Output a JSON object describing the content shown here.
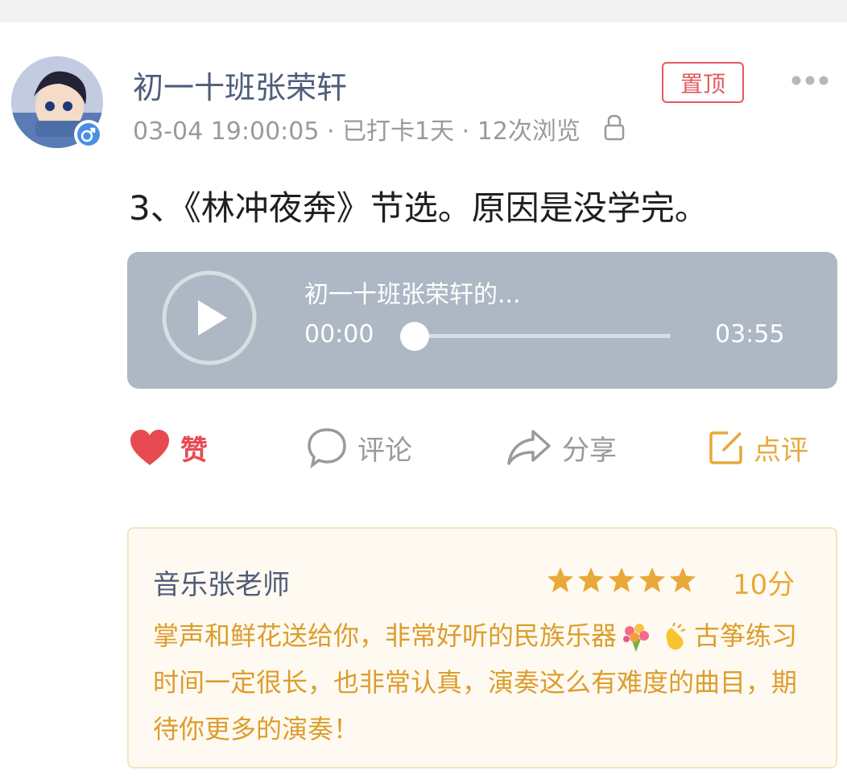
{
  "post": {
    "username": "初一十班张荣轩",
    "meta": "03-04 19:00:05 · 已打卡1天 · 12次浏览",
    "pin_label": "置顶",
    "text": "3、《林冲夜奔》节选。原因是没学完。"
  },
  "audio": {
    "title": "初一十班张荣轩的...",
    "current_time": "00:00",
    "total_time": "03:55",
    "progress": 0.05
  },
  "actions": {
    "like": "赞",
    "comment": "评论",
    "share": "分享",
    "review": "点评"
  },
  "review": {
    "reviewer": "音乐张老师",
    "rating": 5,
    "score": "10分",
    "text_part1": "掌声和鲜花送给你，非常好听的民族乐器",
    "text_part2": "古筝练习时间一定很长，也非常认真，演奏这么有难度的曲目，期待你更多的演奏！"
  },
  "colors": {
    "accent_red": "#e84a52",
    "review_gold": "#e8a93a",
    "audio_bg": "#adb8c4",
    "name_blue": "#4f5d7b"
  },
  "icons": [
    "gender-male-icon",
    "lock-icon",
    "more-icon",
    "play-icon",
    "heart-icon",
    "comment-icon",
    "share-icon",
    "edit-review-icon",
    "star-icon",
    "bouquet-emoji",
    "clap-emoji"
  ]
}
